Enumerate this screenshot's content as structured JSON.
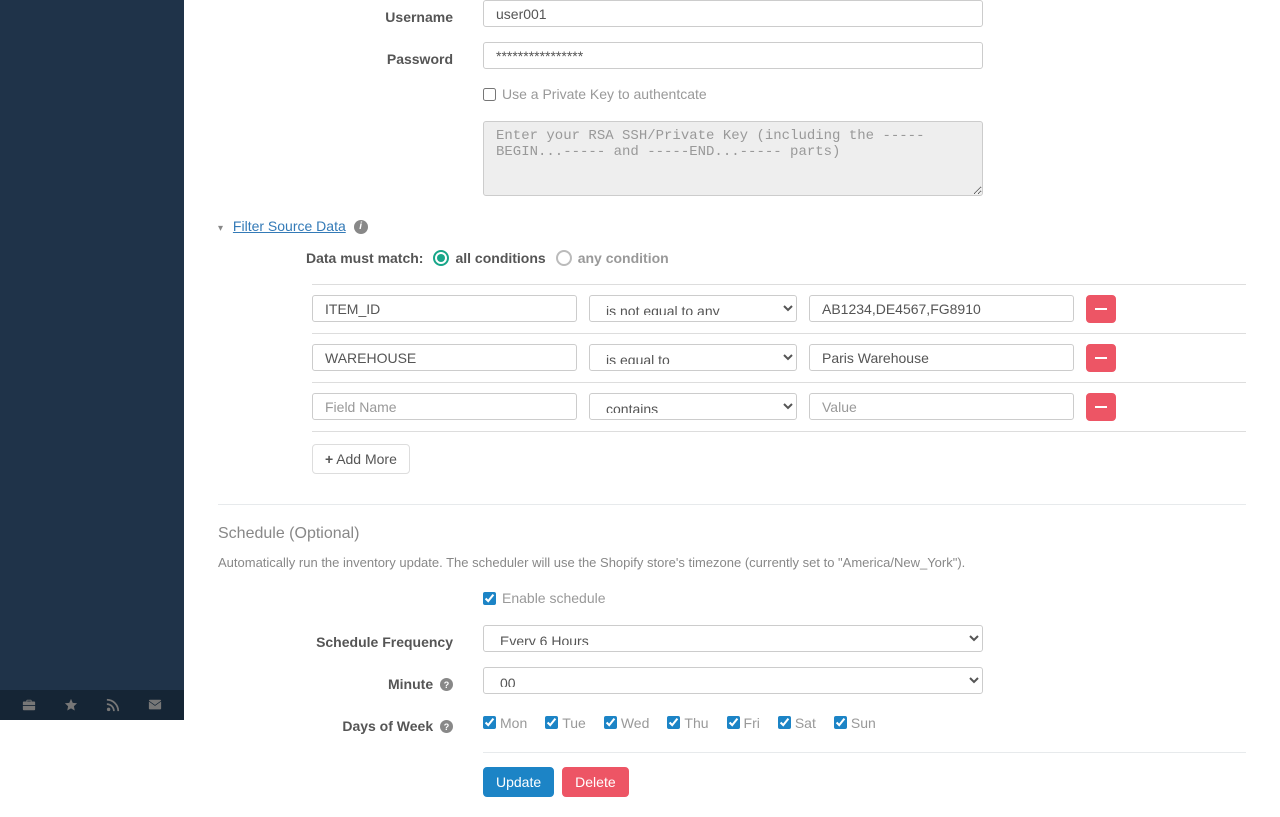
{
  "auth": {
    "username_label": "Username",
    "username_value": "user001",
    "password_label": "Password",
    "password_value": "****************",
    "private_key_checkbox": "Use a Private Key to authentcate",
    "private_key_placeholder": "Enter your RSA SSH/Private Key (including the -----BEGIN...----- and -----END...----- parts)"
  },
  "filter": {
    "header": "Filter Source Data",
    "match_label": "Data must match:",
    "all_label": "all conditions",
    "any_label": "any condition",
    "field_placeholder": "Field Name",
    "value_placeholder": "Value",
    "add_more": "Add More",
    "rows": [
      {
        "field": "ITEM_ID",
        "op": "is not equal to any",
        "val": "AB1234,DE4567,FG8910"
      },
      {
        "field": "WAREHOUSE",
        "op": "is equal to",
        "val": "Paris Warehouse"
      },
      {
        "field": "",
        "op": "contains",
        "val": ""
      }
    ],
    "ops": [
      "contains",
      "is equal to",
      "is not equal to any"
    ]
  },
  "schedule": {
    "title": "Schedule (Optional)",
    "desc": "Automatically run the inventory update. The scheduler will use the Shopify store's timezone (currently set to \"America/New_York\").",
    "enable_label": "Enable schedule",
    "freq_label": "Schedule Frequency",
    "freq_value": "Every 6 Hours",
    "minute_label": "Minute",
    "minute_value": "00",
    "dow_label": "Days of Week",
    "days": [
      "Mon",
      "Tue",
      "Wed",
      "Thu",
      "Fri",
      "Sat",
      "Sun"
    ]
  },
  "actions": {
    "update": "Update",
    "delete": "Delete"
  }
}
